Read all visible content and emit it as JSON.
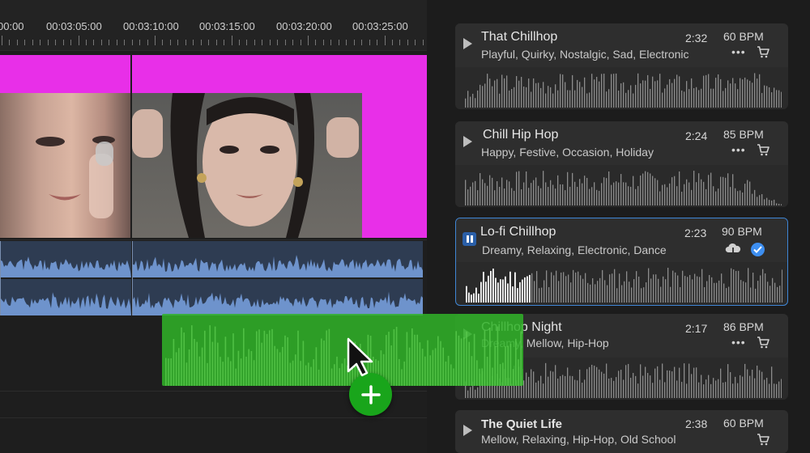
{
  "timeline": {
    "timecodes": [
      "00:00",
      "00:03:05:00",
      "00:03:10:00",
      "00:03:15:00",
      "00:03:20:00",
      "00:03:25:00"
    ]
  },
  "tracks": [
    {
      "title": "That Chillhop",
      "tags": "Playful, Quirky, Nostalgic, Sad, Electronic",
      "duration": "2:32",
      "bpm": "60 BPM",
      "state": "idle"
    },
    {
      "title": "Chill Hip Hop",
      "tags": "Happy, Festive, Occasion, Holiday",
      "duration": "2:24",
      "bpm": "85 BPM",
      "state": "idle"
    },
    {
      "title": "Lo-fi Chillhop",
      "tags": "Dreamy, Relaxing, Electronic, Dance",
      "duration": "2:23",
      "bpm": "90 BPM",
      "state": "playing-licensed"
    },
    {
      "title": "Chillhop Night",
      "tags": "Dreamy, Mellow, Hip-Hop",
      "duration": "2:17",
      "bpm": "86 BPM",
      "state": "idle"
    },
    {
      "title": "The Quiet Life",
      "tags": "Mellow, Relaxing, Hip-Hop, Old School",
      "duration": "2:38",
      "bpm": "60 BPM",
      "state": "idle"
    }
  ],
  "icons": {
    "play": "play-icon",
    "pause": "pause-icon",
    "more": "more-options-icon",
    "cart": "cart-icon",
    "download": "cloud-download-icon",
    "licensed": "checkmark-icon",
    "add": "plus-icon",
    "cursor": "mouse-pointer-icon"
  },
  "colors": {
    "accent": "#3d8ef0",
    "drag_clip": "#30b228",
    "add_badge": "#19a51b",
    "video_background": "#e82fe8",
    "audio_wave": "#6e93cc"
  }
}
